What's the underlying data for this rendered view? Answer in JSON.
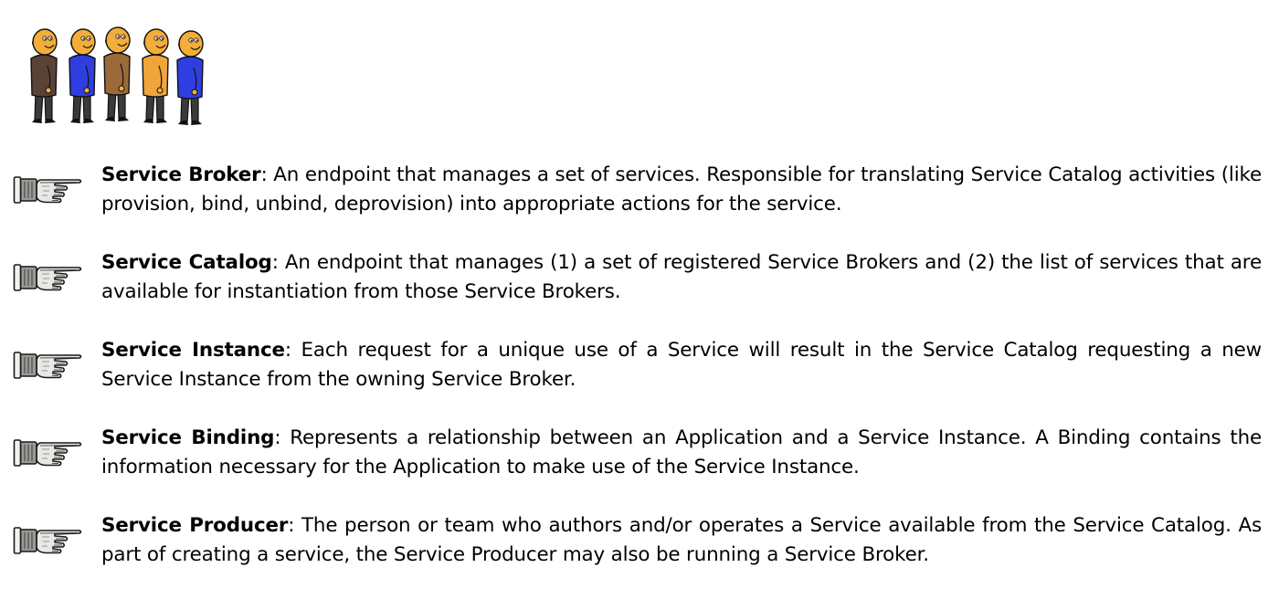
{
  "illustration": {
    "icon": "group-of-people-icon",
    "people": [
      {
        "skin": "#f5ad3a",
        "shirt": "#5a4236"
      },
      {
        "skin": "#f5ad3a",
        "shirt": "#2f3ee0"
      },
      {
        "skin": "#f5ad3a",
        "shirt": "#9a6a3a"
      },
      {
        "skin": "#f5ad3a",
        "shirt": "#f0a43a"
      },
      {
        "skin": "#f5ad3a",
        "shirt": "#2f3ee0"
      }
    ]
  },
  "bullet_icon": "pointing-hand-icon",
  "definitions": [
    {
      "term": "Service Broker",
      "separator": ": ",
      "description": "An endpoint that manages a set of services. Responsible for translating Service Catalog activities (like provision, bind, unbind, deprovision) into appropriate actions for the service."
    },
    {
      "term": "Service Catalog",
      "separator": ": ",
      "description": "An endpoint that manages (1) a set of registered Service Brokers and (2) the list of services that are available for instantiation from those Service Brokers."
    },
    {
      "term": "Service Instance",
      "separator": ": ",
      "description": "Each request for a unique use of a Service will result in the Service Catalog requesting a new Service Instance from the owning Service Broker."
    },
    {
      "term": "Service Binding",
      "separator": ": ",
      "description": "Represents a relationship between an Application and a Service Instance. A Binding contains the information necessary for the Application to make use of the Service Instance."
    },
    {
      "term": "Service Producer",
      "separator": ": ",
      "description": "The person or team who authors and/or operates a Service available from the Service Catalog. As part of creating a service, the Service Producer may also be running a Service Broker."
    }
  ]
}
